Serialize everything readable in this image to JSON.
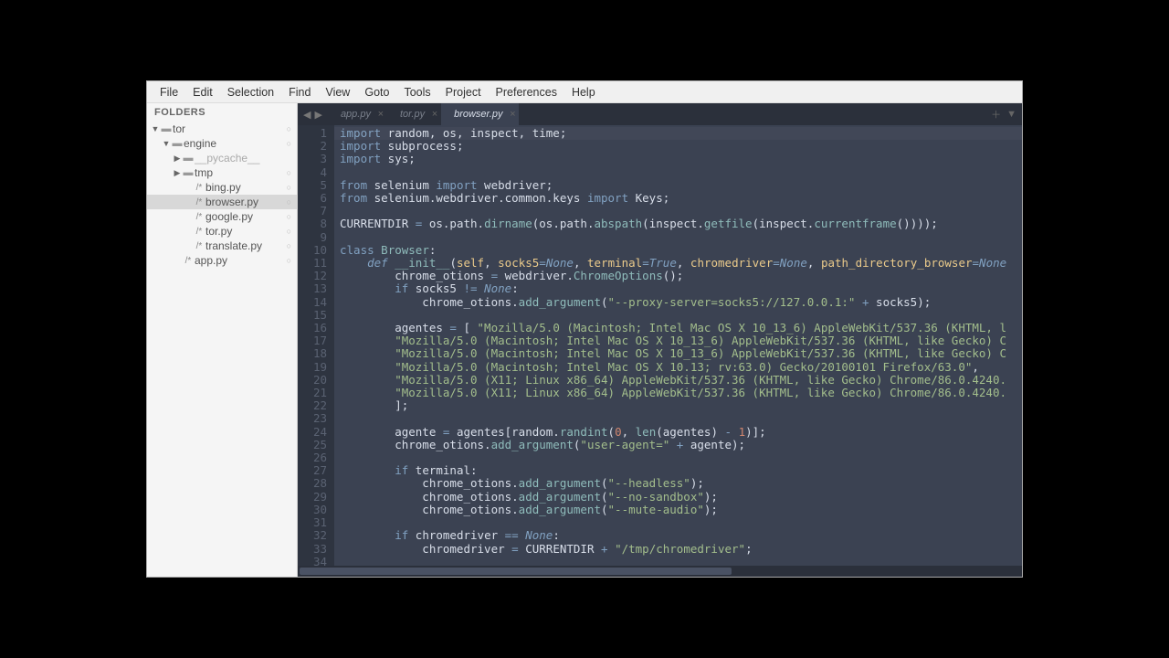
{
  "menu": [
    "File",
    "Edit",
    "Selection",
    "Find",
    "View",
    "Goto",
    "Tools",
    "Project",
    "Preferences",
    "Help"
  ],
  "sidebar": {
    "title": "FOLDERS",
    "tree": [
      {
        "depth": 0,
        "arrow": "▼",
        "icon": "folder",
        "label": "tor",
        "dot": true
      },
      {
        "depth": 1,
        "arrow": "▼",
        "icon": "folder",
        "label": "engine",
        "dot": true
      },
      {
        "depth": 2,
        "arrow": "▶",
        "icon": "folder",
        "label": "__pycache__",
        "dot": false,
        "dim": true
      },
      {
        "depth": 2,
        "arrow": "▶",
        "icon": "folder",
        "label": "tmp",
        "dot": true
      },
      {
        "depth": 3,
        "arrow": "",
        "icon": "py",
        "label": "bing.py",
        "dot": true
      },
      {
        "depth": 3,
        "arrow": "",
        "icon": "py",
        "label": "browser.py",
        "dot": true,
        "selected": true
      },
      {
        "depth": 3,
        "arrow": "",
        "icon": "py",
        "label": "google.py",
        "dot": true
      },
      {
        "depth": 3,
        "arrow": "",
        "icon": "py",
        "label": "tor.py",
        "dot": true
      },
      {
        "depth": 3,
        "arrow": "",
        "icon": "py",
        "label": "translate.py",
        "dot": true
      },
      {
        "depth": 2,
        "arrow": "",
        "icon": "py",
        "label": "app.py",
        "dot": true
      }
    ]
  },
  "tabs": [
    {
      "label": "app.py",
      "active": false
    },
    {
      "label": "tor.py",
      "active": false
    },
    {
      "label": "browser.py",
      "active": true
    }
  ],
  "code": {
    "lines": [
      {
        "n": 1,
        "html": "<span class='kw'>import</span> random, os, inspect, time;"
      },
      {
        "n": 2,
        "html": "<span class='kw'>import</span> subprocess;"
      },
      {
        "n": 3,
        "html": "<span class='kw'>import</span> sys;"
      },
      {
        "n": 4,
        "html": ""
      },
      {
        "n": 5,
        "html": "<span class='kw'>from</span> selenium <span class='kw'>import</span> webdriver;"
      },
      {
        "n": 6,
        "html": "<span class='kw'>from</span> selenium.webdriver.common.keys <span class='kw'>import</span> Keys;"
      },
      {
        "n": 7,
        "html": ""
      },
      {
        "n": 8,
        "html": "CURRENTDIR <span class='op'>=</span> os.path.<span class='fn'>dirname</span>(os.path.<span class='fn'>abspath</span>(inspect.<span class='fn'>getfile</span>(inspect.<span class='fn'>currentframe</span>())));"
      },
      {
        "n": 9,
        "html": ""
      },
      {
        "n": 10,
        "html": "<span class='kw'>class</span> <span class='cls'>Browser</span>:"
      },
      {
        "n": 11,
        "html": "    <span class='def'>def</span> <span class='fn'>__init__</span>(<span class='const'>self</span>, <span class='const'>socks5</span><span class='op'>=</span><span class='none'>None</span>, <span class='const'>terminal</span><span class='op'>=</span><span class='none'>True</span>, <span class='const'>chromedriver</span><span class='op'>=</span><span class='none'>None</span>, <span class='const'>path_directory_browser</span><span class='op'>=</span><span class='none'>None</span>"
      },
      {
        "n": 12,
        "html": "        chrome_otions <span class='op'>=</span> webdriver.<span class='fn'>ChromeOptions</span>();"
      },
      {
        "n": 13,
        "html": "        <span class='kw'>if</span> socks5 <span class='op'>!=</span> <span class='none'>None</span>:"
      },
      {
        "n": 14,
        "html": "            chrome_otions.<span class='fn'>add_argument</span>(<span class='str'>\"--proxy-server=socks5://127.0.0.1:\"</span> <span class='op'>+</span> socks5);"
      },
      {
        "n": 15,
        "html": ""
      },
      {
        "n": 16,
        "html": "        agentes <span class='op'>=</span> [ <span class='str'>\"Mozilla/5.0 (Macintosh; Intel Mac OS X 10_13_6) AppleWebKit/537.36 (KHTML, l</span>"
      },
      {
        "n": 17,
        "html": "        <span class='str'>\"Mozilla/5.0 (Macintosh; Intel Mac OS X 10_13_6) AppleWebKit/537.36 (KHTML, like Gecko) C</span>"
      },
      {
        "n": 18,
        "html": "        <span class='str'>\"Mozilla/5.0 (Macintosh; Intel Mac OS X 10_13_6) AppleWebKit/537.36 (KHTML, like Gecko) C</span>"
      },
      {
        "n": 19,
        "html": "        <span class='str'>\"Mozilla/5.0 (Macintosh; Intel Mac OS X 10.13; rv:63.0) Gecko/20100101 Firefox/63.0\"</span>,"
      },
      {
        "n": 20,
        "html": "        <span class='str'>\"Mozilla/5.0 (X11; Linux x86_64) AppleWebKit/537.36 (KHTML, like Gecko) Chrome/86.0.4240.</span>"
      },
      {
        "n": 21,
        "html": "        <span class='str'>\"Mozilla/5.0 (X11; Linux x86_64) AppleWebKit/537.36 (KHTML, like Gecko) Chrome/86.0.4240.</span>"
      },
      {
        "n": 22,
        "html": "        ];"
      },
      {
        "n": 23,
        "html": ""
      },
      {
        "n": 24,
        "html": "        agente <span class='op'>=</span> agentes[random.<span class='fn'>randint</span>(<span class='num'>0</span>, <span class='fn'>len</span>(agentes) <span class='op'>-</span> <span class='num'>1</span>)];"
      },
      {
        "n": 25,
        "html": "        chrome_otions.<span class='fn'>add_argument</span>(<span class='str'>\"user-agent=\"</span> <span class='op'>+</span> agente);"
      },
      {
        "n": 26,
        "html": ""
      },
      {
        "n": 27,
        "html": "        <span class='kw'>if</span> terminal:"
      },
      {
        "n": 28,
        "html": "            chrome_otions.<span class='fn'>add_argument</span>(<span class='str'>\"--headless\"</span>);"
      },
      {
        "n": 29,
        "html": "            chrome_otions.<span class='fn'>add_argument</span>(<span class='str'>\"--no-sandbox\"</span>);"
      },
      {
        "n": 30,
        "html": "            chrome_otions.<span class='fn'>add_argument</span>(<span class='str'>\"--mute-audio\"</span>);"
      },
      {
        "n": 31,
        "html": ""
      },
      {
        "n": 32,
        "html": "        <span class='kw'>if</span> chromedriver <span class='op'>==</span> <span class='none'>None</span>:"
      },
      {
        "n": 33,
        "html": "            chromedriver <span class='op'>=</span> CURRENTDIR <span class='op'>+</span> <span class='str'>\"/tmp/chromedriver\"</span>;"
      },
      {
        "n": 34,
        "html": ""
      }
    ]
  }
}
